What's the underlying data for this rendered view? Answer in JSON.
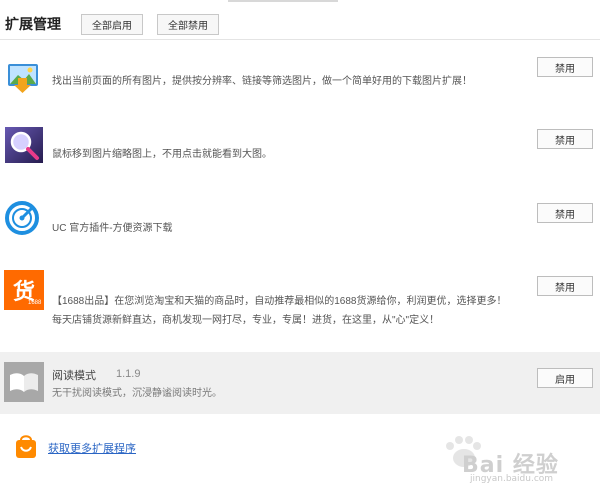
{
  "header": {
    "title": "扩展管理",
    "enable_all": "全部启用",
    "disable_all": "全部禁用"
  },
  "extensions": [
    {
      "icon": "image-download-icon",
      "desc": "找出当前页面的所有图片，提供按分辨率、链接等筛选图片，做一个简单好用的下载图片扩展！",
      "button": "禁用"
    },
    {
      "icon": "magnifier-icon",
      "desc": "鼠标移到图片缩略图上，不用点击就能看到大图。",
      "button": "禁用"
    },
    {
      "icon": "uc-icon",
      "desc": "UC 官方插件-方便资源下载",
      "button": "禁用"
    },
    {
      "icon": "huo-shopping-icon",
      "icon_text": "货",
      "icon_sub": "1688",
      "desc_line1": "【1688出品】在您浏览淘宝和天猫的商品时，自动推荐最相似的1688货源给你，利润更优，选择更多！",
      "desc_line2": "每天店铺货源新鲜直达，商机发现一网打尽，专业，专属！进货，在这里，从\"心\"定义！",
      "button": "禁用"
    },
    {
      "icon": "book-icon",
      "name": "阅读模式",
      "version": "1.1.9",
      "desc": "无干扰阅读模式，沉浸静谧阅读时光。",
      "button": "启用",
      "disabled": true
    }
  ],
  "footer": {
    "more_link": "获取更多扩展程序",
    "icon": "shopping-bag-icon"
  },
  "watermark": {
    "text": "Bai 经验",
    "sub": "jingyan.baidu.com"
  },
  "colors": {
    "link": "#2a65c4",
    "uc_blue": "#1e8fe0",
    "huo_orange": "#ff6a00",
    "disabled_bg": "#f0f0f0"
  }
}
